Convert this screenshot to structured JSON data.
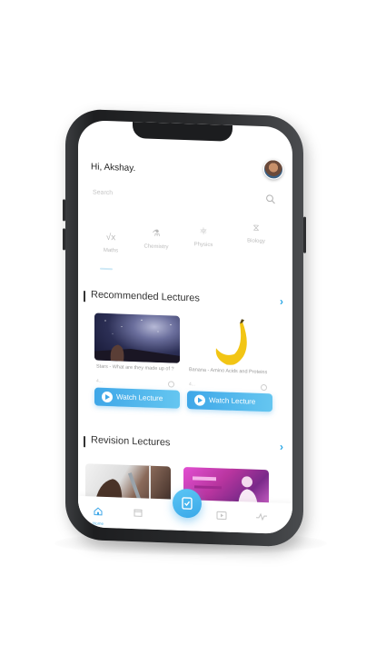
{
  "header": {
    "greeting": "Hi, Akshay."
  },
  "search": {
    "placeholder": "Search"
  },
  "subjects": [
    "Maths",
    "Chemistry",
    "Physics",
    "Biology"
  ],
  "recommended": {
    "title": "Recommended Lectures",
    "cards": [
      {
        "title": "Stars - What are they made up of ?",
        "meta": "4...",
        "button": "Watch Lecture"
      },
      {
        "title": "Banana - Amino Acids and Proteins",
        "meta": "4...",
        "button": "Watch Lecture"
      }
    ]
  },
  "revision": {
    "title": "Revision Lectures"
  },
  "bottom_nav": {
    "home_label": "Home"
  },
  "colors": {
    "accent": "#3fa7e8",
    "accent_light": "#65c6f0",
    "text_dark": "#333333",
    "text_muted": "#9a9a9a"
  },
  "icons": [
    "home-icon",
    "calendar-icon",
    "task-check-icon",
    "play-icon",
    "activity-icon",
    "search-icon",
    "chevron-right-icon"
  ]
}
